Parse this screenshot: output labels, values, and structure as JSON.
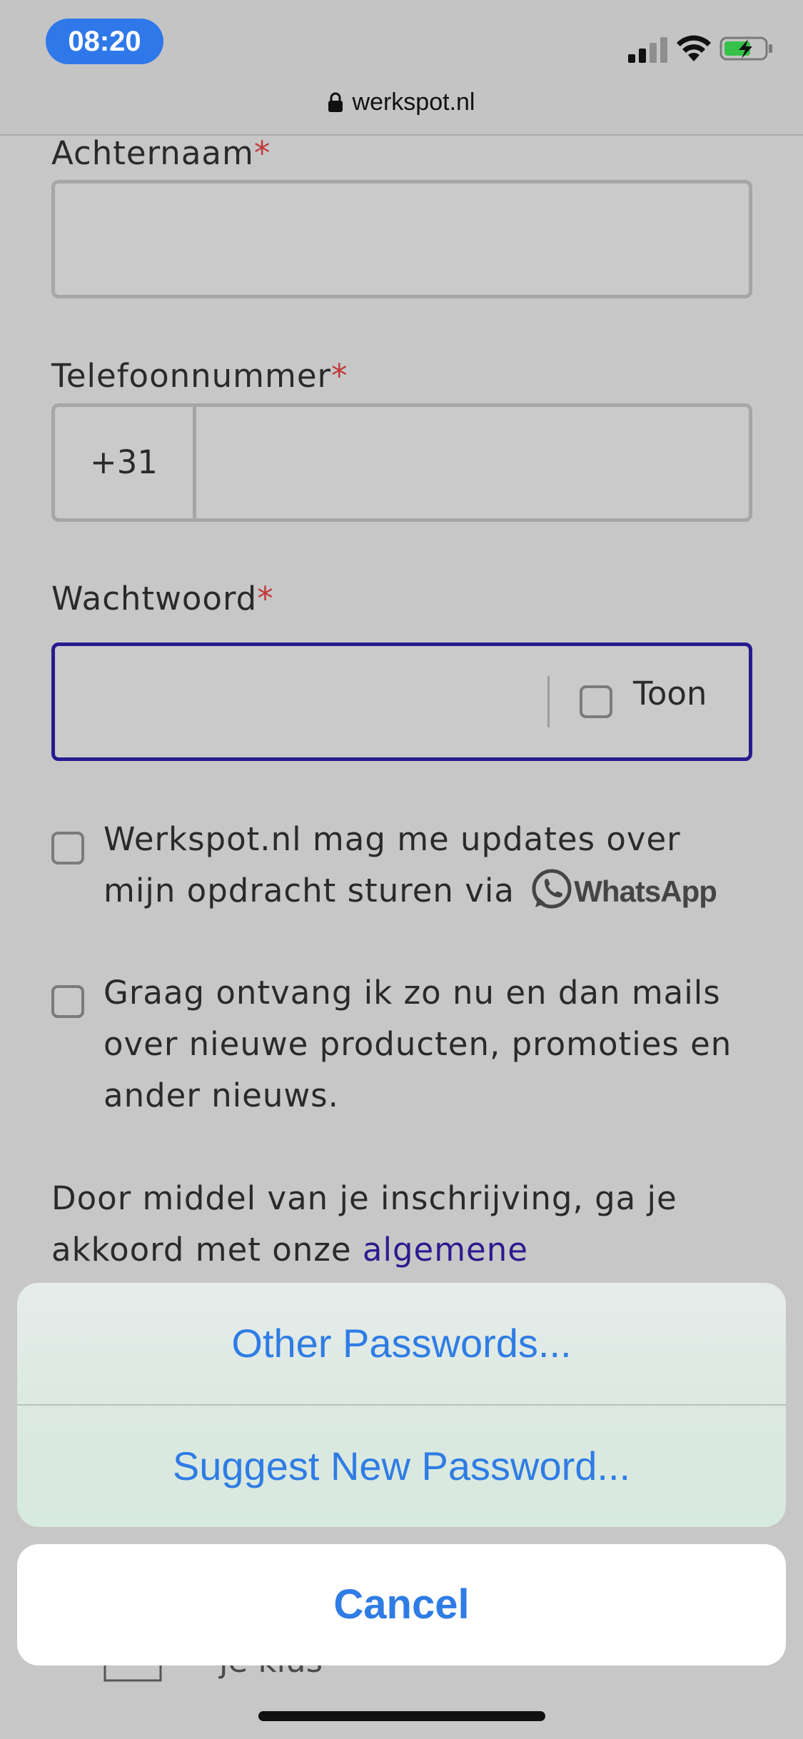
{
  "status_bar": {
    "time": "08:20",
    "icons": [
      "cellular-signal-icon",
      "wifi-icon",
      "battery-charging-icon"
    ],
    "url": "werkspot.nl"
  },
  "form": {
    "last_name": {
      "label": "Achternaam",
      "required_mark": "*",
      "value": ""
    },
    "phone": {
      "label": "Telefoonnummer",
      "required_mark": "*",
      "country_code": "+31",
      "value": ""
    },
    "password": {
      "label": "Wachtwoord",
      "required_mark": "*",
      "value": "",
      "show_label": "Toon",
      "show_checked": false
    },
    "whatsapp_optin": {
      "checked": false,
      "text": "Werkspot.nl mag me updates over mijn opdracht sturen via",
      "brand": "WhatsApp"
    },
    "newsletter_optin": {
      "checked": false,
      "text": "Graag ontvang ik zo nu en dan mails over nieuwe producten, promoties en ander nieuws."
    },
    "terms": {
      "text": "Door middel van je inschrijving, ga je akkoord met onze ",
      "link": "algemene"
    }
  },
  "background_footer": {
    "text": "je klus"
  },
  "action_sheet": {
    "options": [
      "Other Passwords...",
      "Suggest New Password..."
    ],
    "cancel": "Cancel"
  },
  "colors": {
    "accent_blue": "#2f7ce4",
    "time_pill": "#2f78ea",
    "focus_border": "#281a8f",
    "required": "#c23a3a",
    "link": "#2a1b8f"
  }
}
